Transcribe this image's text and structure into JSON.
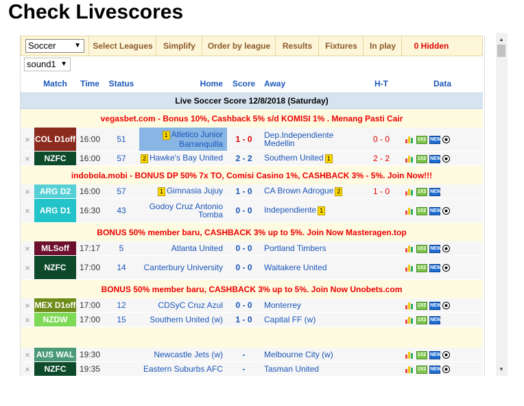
{
  "page_title": "Check Livescores",
  "toolbar": {
    "sport_select": "Soccer",
    "buttons": [
      "Select Leagues",
      "Simplify",
      "Order by league",
      "Results",
      "Fixtures",
      "In play",
      "0 Hidden"
    ]
  },
  "sound_select": "sound1",
  "columns": {
    "match": "Match",
    "time": "Time",
    "status": "Status",
    "home": "Home",
    "score": "Score",
    "away": "Away",
    "ht": "H-T",
    "data": "Data"
  },
  "banner": "Live Soccer Score 12/8/2018 (Saturday)",
  "remove_glyph": "×",
  "sections": [
    {
      "ad": "vegasbet.com - Bonus 10%, Cashback 5% s/d KOMISI 1% . Menang Pasti Cair",
      "matches": [
        {
          "league": "COL D1off",
          "league_color": "#8b2a1e",
          "time": "16:00",
          "status": "51",
          "home": "Atletico Junior Barranquilla",
          "home_badge": "1",
          "home_highlight": true,
          "score": "1 - 0",
          "score_red": true,
          "away": "Dep.Independiente Medellin",
          "away_badge": "",
          "ht": "0 - 0",
          "ball": true
        },
        {
          "league": "NZFC",
          "league_color": "#0d4a2a",
          "time": "16:00",
          "status": "57",
          "home": "Hawke's Bay United",
          "home_badge": "2",
          "home_highlight": false,
          "score": "2 - 2",
          "score_red": false,
          "away": "Southern United",
          "away_badge": "1",
          "ht": "2 - 2",
          "ball": true
        }
      ]
    },
    {
      "ad": "indobola.mobi - BONUS DP 50% 7x TO, Comisi Casino 1%, CASHBACK 3% - 5%. Join Now!!!",
      "matches": [
        {
          "league": "ARG D2",
          "league_color": "#56d0d6",
          "time": "16:00",
          "status": "57",
          "home": "Gimnasia Jujuy",
          "home_badge": "1",
          "home_highlight": false,
          "score": "1 - 0",
          "score_red": false,
          "away": "CA Brown Adrogue",
          "away_badge": "2",
          "ht": "1 - 0",
          "ball": false
        },
        {
          "league": "ARG D1",
          "league_color": "#22c3c9",
          "time": "16:30",
          "status": "43",
          "home": "Godoy Cruz Antonio Tomba",
          "home_badge": "",
          "home_highlight": false,
          "score": "0 - 0",
          "score_red": false,
          "away": "Independiente",
          "away_badge": "1",
          "ht": "",
          "ball": true
        }
      ]
    },
    {
      "ad": "BONUS 50% member baru, CASHBACK 3% up to 5%. Join Now Masteragen.top",
      "matches": [
        {
          "league": "MLSoff",
          "league_color": "#6e0f2e",
          "time": "17:17",
          "status": "5",
          "home": "Atlanta United",
          "home_badge": "",
          "home_highlight": false,
          "score": "0 - 0",
          "score_red": false,
          "away": "Portland Timbers",
          "away_badge": "",
          "ht": "",
          "ball": true
        },
        {
          "league": "NZFC",
          "league_color": "#0d4a2a",
          "time": "17:00",
          "status": "14",
          "home": "Canterbury University",
          "home_badge": "",
          "home_highlight": false,
          "score": "0 - 0",
          "score_red": false,
          "away": "Waitakere United",
          "away_badge": "",
          "ht": "",
          "ball": true
        }
      ]
    },
    {
      "ad": "BONUS 50% member baru, CASHBACK 3% up to 5%. Join Now Unobets.com",
      "matches": [
        {
          "league": "MEX D1off",
          "league_color": "#6e8c1a",
          "time": "17:00",
          "status": "12",
          "home": "CDSyC Cruz Azul",
          "home_badge": "",
          "home_highlight": false,
          "score": "0 - 0",
          "score_red": false,
          "away": "Monterrey",
          "away_badge": "",
          "ht": "",
          "ball": true
        },
        {
          "league": "NZDW",
          "league_color": "#7ed957",
          "time": "17:00",
          "status": "15",
          "home": "Southern United (w)",
          "home_badge": "",
          "home_highlight": false,
          "score": "1 - 0",
          "score_red": false,
          "away": "Capital FF (w)",
          "away_badge": "",
          "ht": "",
          "ball": false
        }
      ]
    },
    {
      "ad": "",
      "matches": [
        {
          "league": "AUS WAL",
          "league_color": "#4a9a7a",
          "time": "19:30",
          "status": "",
          "home": "Newcastle Jets (w)",
          "home_badge": "",
          "home_highlight": false,
          "score": "-",
          "score_red": false,
          "away": "Melbourne City (w)",
          "away_badge": "",
          "ht": "",
          "ball": true
        },
        {
          "league": "NZFC",
          "league_color": "#0d4a2a",
          "time": "19:35",
          "status": "",
          "home": "Eastern Suburbs AFC",
          "home_badge": "",
          "home_highlight": false,
          "score": "-",
          "score_red": false,
          "away": "Tasman United",
          "away_badge": "",
          "ht": "",
          "ball": true
        }
      ]
    }
  ],
  "data_icons": {
    "stats": "bar-chart-icon",
    "odds": "1x2-icon",
    "new": "new-icon",
    "ball": "soccer-ball-icon",
    "odds_text": "1X2",
    "new_text": "NEW"
  }
}
